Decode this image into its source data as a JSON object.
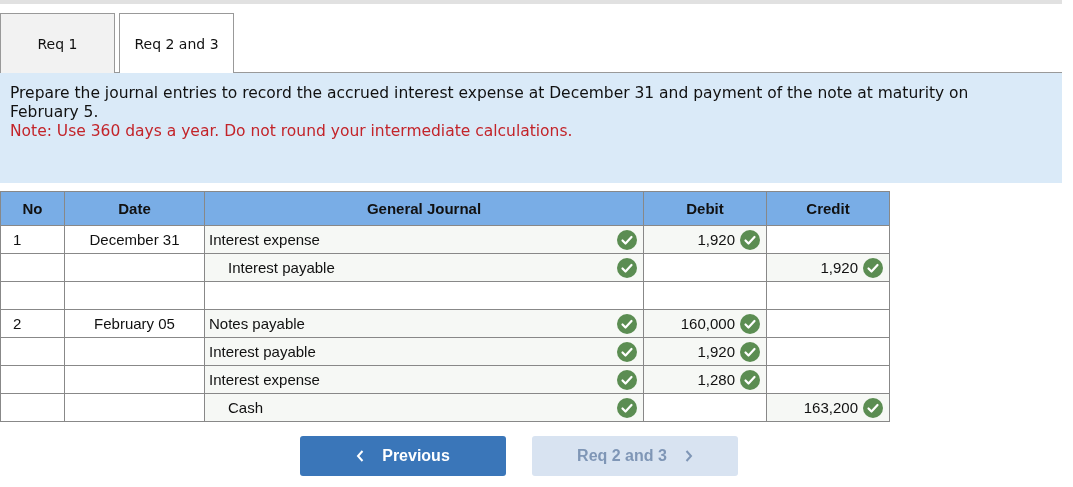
{
  "tabs": [
    {
      "label": "Req 1",
      "selected": false
    },
    {
      "label": "Req 2 and 3",
      "selected": true
    }
  ],
  "instructions": {
    "text": "Prepare the journal entries to record the accrued interest expense at December 31 and payment of the note at maturity on February 5.",
    "note": "Note: Use 360 days a year. Do not round your intermediate calculations."
  },
  "journal": {
    "columns": [
      "No",
      "Date",
      "General Journal",
      "Debit",
      "Credit"
    ],
    "rows": [
      {
        "kind": "entry",
        "no": "1",
        "date": "December 31",
        "account": "Interest expense",
        "indented": false,
        "account_checked": true,
        "debit": "1,920",
        "debit_checked": true
      },
      {
        "kind": "entry",
        "account": "Interest payable",
        "indented": true,
        "account_checked": true,
        "credit": "1,920",
        "credit_checked": true
      },
      {
        "kind": "blank"
      },
      {
        "kind": "entry",
        "no": "2",
        "date": "February 05",
        "account": "Notes payable",
        "indented": false,
        "account_checked": true,
        "debit": "160,000",
        "debit_checked": true
      },
      {
        "kind": "entry",
        "account": "Interest payable",
        "indented": false,
        "account_checked": true,
        "debit": "1,920",
        "debit_checked": true
      },
      {
        "kind": "entry",
        "account": "Interest expense",
        "indented": false,
        "account_checked": true,
        "debit": "1,280",
        "debit_checked": true
      },
      {
        "kind": "entry",
        "account": "Cash",
        "indented": true,
        "account_checked": true,
        "credit": "163,200",
        "credit_checked": true
      }
    ]
  },
  "nav": [
    {
      "label": "Previous",
      "kind": "back",
      "disabled": false
    },
    {
      "label": "Req 2 and 3",
      "kind": "forward",
      "disabled": true
    }
  ]
}
